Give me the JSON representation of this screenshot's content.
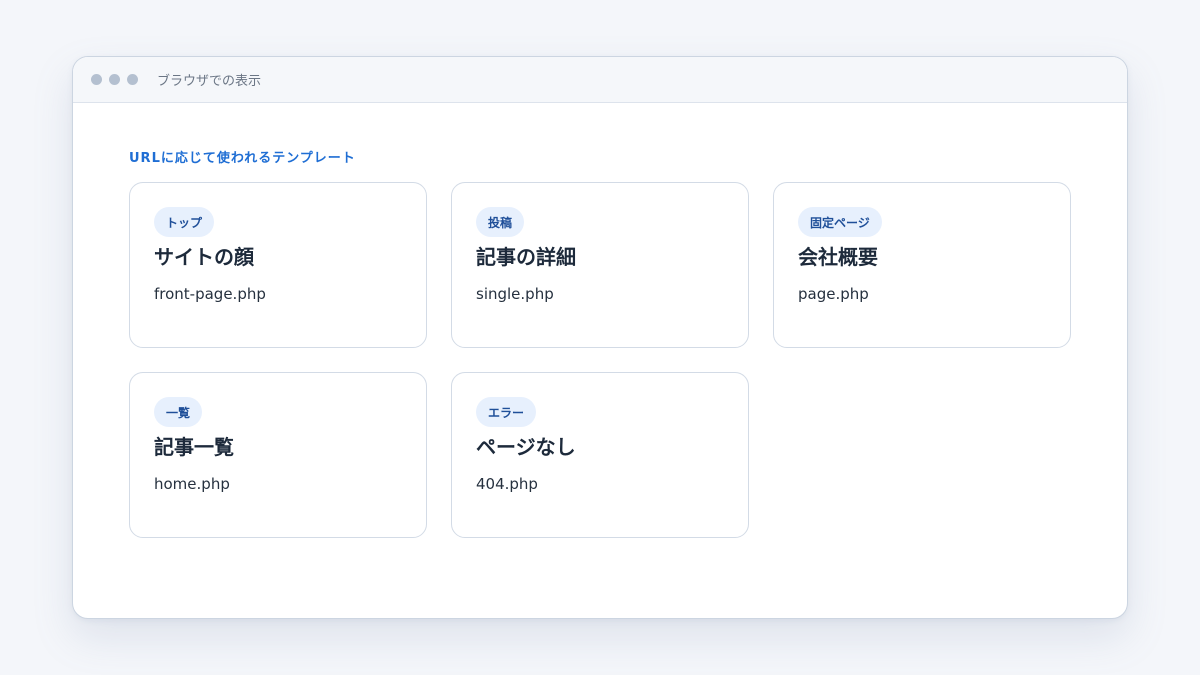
{
  "window": {
    "title": "ブラウザでの表示"
  },
  "section": {
    "label": "URLに応じて使われるテンプレート"
  },
  "cards": [
    {
      "badge": "トップ",
      "title": "サイトの顔",
      "file": "front-page.php"
    },
    {
      "badge": "投稿",
      "title": "記事の詳細",
      "file": "single.php"
    },
    {
      "badge": "固定ページ",
      "title": "会社概要",
      "file": "page.php"
    },
    {
      "badge": "一覧",
      "title": "記事一覧",
      "file": "home.php"
    },
    {
      "badge": "エラー",
      "title": "ページなし",
      "file": "404.php"
    }
  ],
  "colors": {
    "accent": "#1f6ed4",
    "badge_bg": "#e7f0fd",
    "badge_text": "#1f4f99",
    "title_text": "#1d2a3b"
  }
}
